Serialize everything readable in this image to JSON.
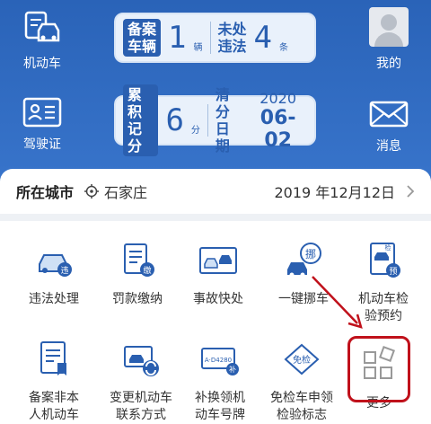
{
  "header": {
    "vehicle_label": "机动车",
    "license_label": "驾驶证",
    "mine_label": "我的",
    "messages_label": "消息",
    "vehicle_panel": {
      "registered_label_1": "备案",
      "registered_label_2": "车辆",
      "registered_count": "1",
      "registered_unit": "辆",
      "violations_label_1": "未处",
      "violations_label_2": "违法",
      "violations_count": "4",
      "violations_unit": "条"
    },
    "license_panel": {
      "points_label_1": "累积",
      "points_label_2": "记分",
      "points_value": "6",
      "points_unit": "分",
      "clear_label_1": "清分",
      "clear_label_2": "日期",
      "clear_year": "2020",
      "clear_date": "06-02"
    }
  },
  "city_bar": {
    "label": "所在城市",
    "city": "石家庄",
    "date": "2019 年12月12日"
  },
  "services": [
    {
      "label": "违法处理",
      "icon": "violation-car-icon"
    },
    {
      "label": "罚款缴纳",
      "icon": "fine-payment-icon"
    },
    {
      "label": "事故快处",
      "icon": "accident-icon"
    },
    {
      "label": "一键挪车",
      "icon": "move-car-icon"
    },
    {
      "label": "机动车检\n验预约",
      "icon": "inspection-booking-icon"
    },
    {
      "label": "备案非本\n人机动车",
      "icon": "register-vehicle-icon"
    },
    {
      "label": "变更机动车\n联系方式",
      "icon": "change-contact-icon"
    },
    {
      "label": "补换领机\n动车号牌",
      "icon": "plate-replace-icon"
    },
    {
      "label": "免检车申领\n检验标志",
      "icon": "exempt-sticker-icon"
    },
    {
      "label": "更多",
      "icon": "more-icon"
    }
  ],
  "icon_texts": {
    "violation": "违",
    "fine": "缴",
    "move": "挪",
    "inspection": "检",
    "reservation": "预",
    "plate": "A·D4280",
    "exempt": "免检",
    "supplement": "补"
  },
  "colors": {
    "header_blue": "#2a63b8",
    "accent_blue": "#2a5fb0",
    "highlight_red": "#c0111b"
  }
}
